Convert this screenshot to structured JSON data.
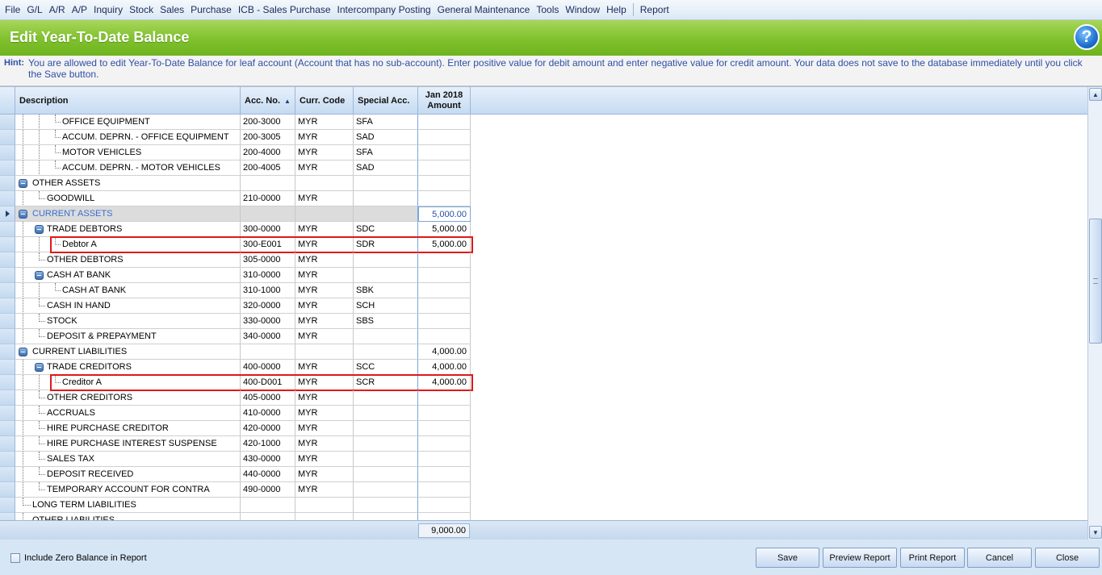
{
  "menu": [
    "File",
    "G/L",
    "A/R",
    "A/P",
    "Inquiry",
    "Stock",
    "Sales",
    "Purchase",
    "ICB - Sales Purchase",
    "Intercompany Posting",
    "General Maintenance",
    "Tools",
    "Window",
    "Help",
    "Report"
  ],
  "title": "Edit Year-To-Date Balance",
  "help_icon": "?",
  "hint": {
    "label": "Hint:",
    "text": "You are allowed to edit Year-To-Date Balance for leaf account (Account that has no sub-account). Enter positive value for debit amount and enter negative value for credit amount. Your data does not save to the database immediately until you click the Save button."
  },
  "columns": {
    "description": "Description",
    "acc_no": "Acc. No.",
    "curr_code": "Curr. Code",
    "special_acc": "Special Acc.",
    "amount_line1": "Jan 2018",
    "amount_line2": "Amount"
  },
  "rows": [
    {
      "desc": "OFFICE EQUIPMENT",
      "acc": "200-3000",
      "curr": "MYR",
      "spec": "SFA",
      "amt": "",
      "level": 3
    },
    {
      "desc": "ACCUM. DEPRN. - OFFICE EQUIPMENT",
      "acc": "200-3005",
      "curr": "MYR",
      "spec": "SAD",
      "amt": "",
      "level": 3
    },
    {
      "desc": "MOTOR VEHICLES",
      "acc": "200-4000",
      "curr": "MYR",
      "spec": "SFA",
      "amt": "",
      "level": 3
    },
    {
      "desc": "ACCUM. DEPRN. - MOTOR VEHICLES",
      "acc": "200-4005",
      "curr": "MYR",
      "spec": "SAD",
      "amt": "",
      "level": 3
    },
    {
      "desc": "OTHER ASSETS",
      "acc": "",
      "curr": "",
      "spec": "",
      "amt": "",
      "level": 1
    },
    {
      "desc": "GOODWILL",
      "acc": "210-0000",
      "curr": "MYR",
      "spec": "",
      "amt": "",
      "level": 2
    },
    {
      "desc": "CURRENT ASSETS",
      "acc": "",
      "curr": "",
      "spec": "",
      "amt": "5,000.00",
      "level": 1
    },
    {
      "desc": "TRADE DEBTORS",
      "acc": "300-0000",
      "curr": "MYR",
      "spec": "SDC",
      "amt": "5,000.00",
      "level": 2
    },
    {
      "desc": "Debtor A",
      "acc": "300-E001",
      "curr": "MYR",
      "spec": "SDR",
      "amt": "5,000.00",
      "level": 3
    },
    {
      "desc": "OTHER DEBTORS",
      "acc": "305-0000",
      "curr": "MYR",
      "spec": "",
      "amt": "",
      "level": 2
    },
    {
      "desc": "CASH AT BANK",
      "acc": "310-0000",
      "curr": "MYR",
      "spec": "",
      "amt": "",
      "level": 2
    },
    {
      "desc": "CASH AT BANK",
      "acc": "310-1000",
      "curr": "MYR",
      "spec": "SBK",
      "amt": "",
      "level": 3
    },
    {
      "desc": "CASH IN HAND",
      "acc": "320-0000",
      "curr": "MYR",
      "spec": "SCH",
      "amt": "",
      "level": 2
    },
    {
      "desc": "STOCK",
      "acc": "330-0000",
      "curr": "MYR",
      "spec": "SBS",
      "amt": "",
      "level": 2
    },
    {
      "desc": "DEPOSIT & PREPAYMENT",
      "acc": "340-0000",
      "curr": "MYR",
      "spec": "",
      "amt": "",
      "level": 2
    },
    {
      "desc": "CURRENT LIABILITIES",
      "acc": "",
      "curr": "",
      "spec": "",
      "amt": "4,000.00",
      "level": 1
    },
    {
      "desc": "TRADE CREDITORS",
      "acc": "400-0000",
      "curr": "MYR",
      "spec": "SCC",
      "amt": "4,000.00",
      "level": 2
    },
    {
      "desc": "Creditor A",
      "acc": "400-D001",
      "curr": "MYR",
      "spec": "SCR",
      "amt": "4,000.00",
      "level": 3
    },
    {
      "desc": "OTHER CREDITORS",
      "acc": "405-0000",
      "curr": "MYR",
      "spec": "",
      "amt": "",
      "level": 2
    },
    {
      "desc": "ACCRUALS",
      "acc": "410-0000",
      "curr": "MYR",
      "spec": "",
      "amt": "",
      "level": 2
    },
    {
      "desc": "HIRE PURCHASE CREDITOR",
      "acc": "420-0000",
      "curr": "MYR",
      "spec": "",
      "amt": "",
      "level": 2
    },
    {
      "desc": "HIRE PURCHASE INTEREST SUSPENSE",
      "acc": "420-1000",
      "curr": "MYR",
      "spec": "",
      "amt": "",
      "level": 2
    },
    {
      "desc": "SALES TAX",
      "acc": "430-0000",
      "curr": "MYR",
      "spec": "",
      "amt": "",
      "level": 2
    },
    {
      "desc": "DEPOSIT RECEIVED",
      "acc": "440-0000",
      "curr": "MYR",
      "spec": "",
      "amt": "",
      "level": 2
    },
    {
      "desc": "TEMPORARY ACCOUNT FOR CONTRA",
      "acc": "490-0000",
      "curr": "MYR",
      "spec": "",
      "amt": "",
      "level": 2
    },
    {
      "desc": "LONG TERM LIABILITIES",
      "acc": "",
      "curr": "",
      "spec": "",
      "amt": "",
      "level": 1
    },
    {
      "desc": "OTHER LIABILITIES",
      "acc": "",
      "curr": "",
      "spec": "",
      "amt": "",
      "level": 1
    }
  ],
  "current_row_desc": "CURRENT ASSETS",
  "highlighted_rows": [
    "Debtor A",
    "Creditor A"
  ],
  "total_amount": "9,000.00",
  "include_zero_label": "Include Zero Balance in Report",
  "buttons": {
    "save": "Save",
    "preview": "Preview Report",
    "print": "Print Report",
    "cancel": "Cancel",
    "close": "Close"
  },
  "colors": {
    "title_bar": "#7ec12c",
    "hint_text": "#2f4fa8",
    "highlight_border": "#e01818"
  }
}
